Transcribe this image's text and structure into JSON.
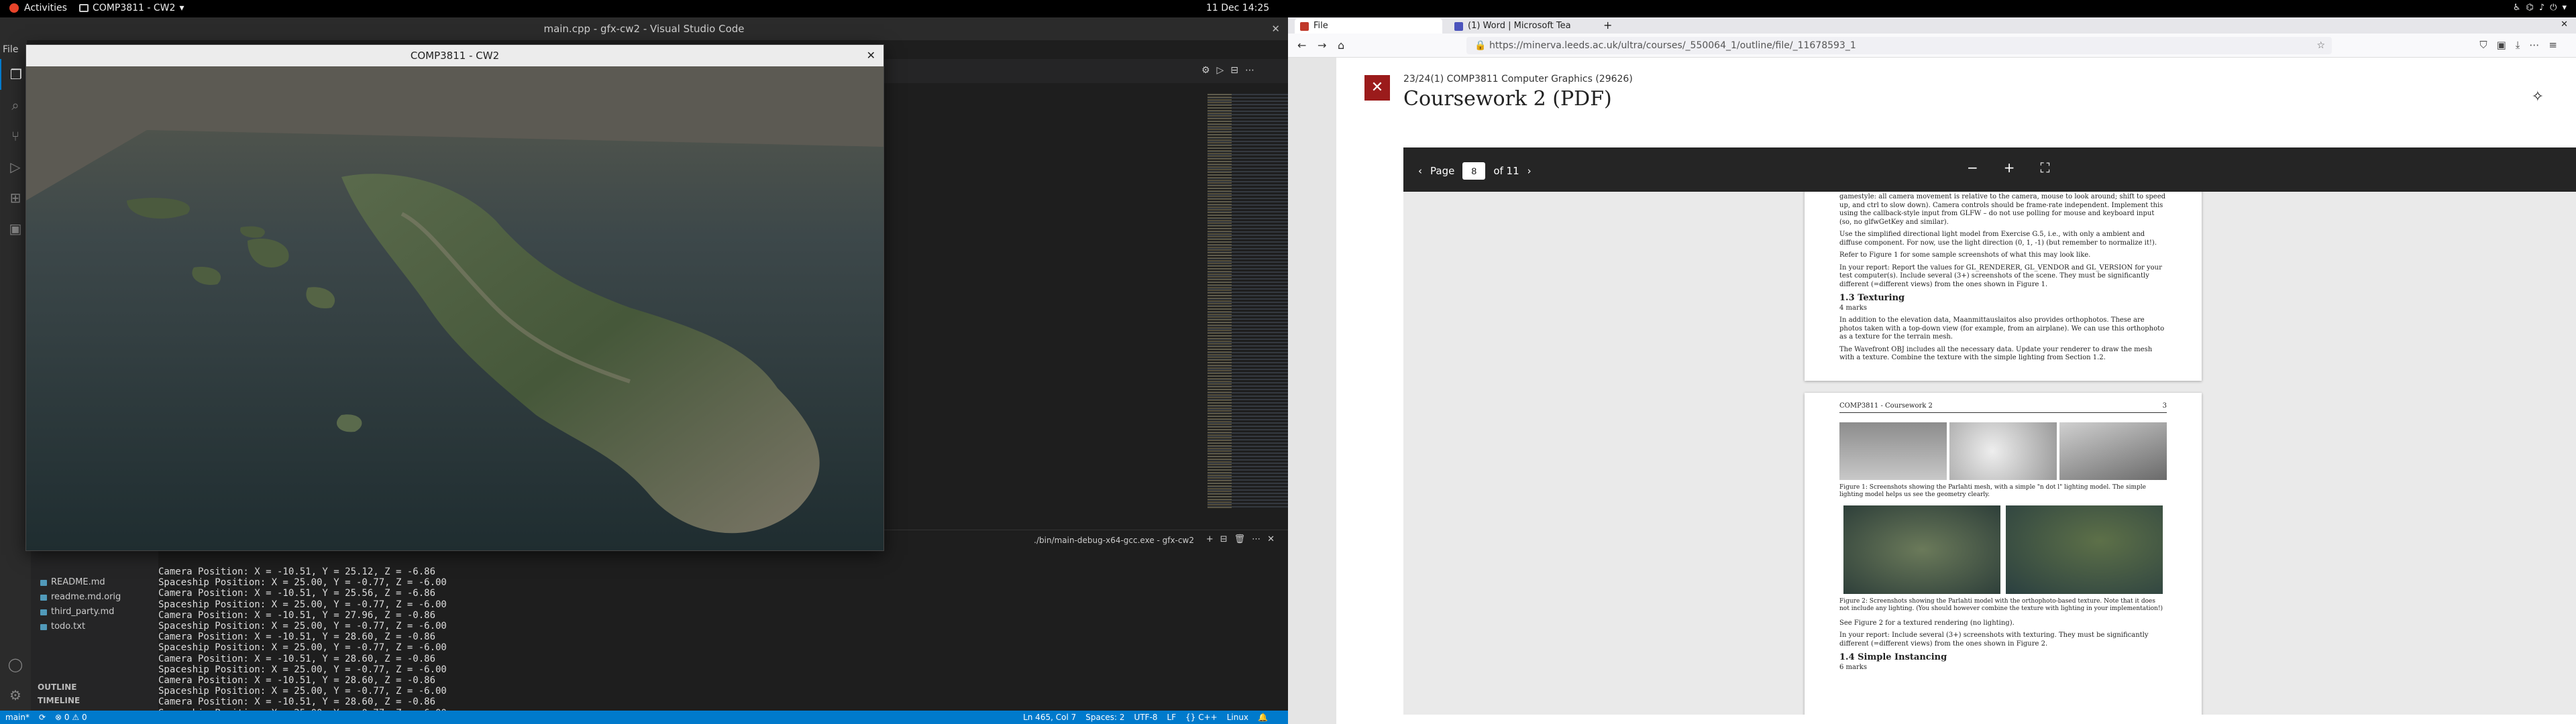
{
  "topbar": {
    "activities": "Activities",
    "app_name": "COMP3811 - CW2",
    "clock": "11 Dec  14:25"
  },
  "vscode": {
    "title": "main.cpp - gfx-cw2 - Visual Studio Code",
    "menu_first": "File",
    "files": [
      "README.md",
      "readme.md.orig",
      "third_party.md",
      "todo.txt"
    ],
    "outline_label": "OUTLINE",
    "timeline_label": "TIMELINE",
    "terminal_label": "./bin/main-debug-x64-gcc.exe - gfx-cw2",
    "terminal_lines": [
      "Camera Position: X = -10.51, Y = 25.12, Z = -6.86",
      "Spaceship Position: X = 25.00, Y = -0.77, Z = -6.00",
      "Camera Position: X = -10.51, Y = 25.56, Z = -6.86",
      "Spaceship Position: X = 25.00, Y = -0.77, Z = -6.00",
      "Camera Position: X = -10.51, Y = 27.96, Z = -0.86",
      "Spaceship Position: X = 25.00, Y = -0.77, Z = -6.00",
      "Camera Position: X = -10.51, Y = 28.60, Z = -0.86",
      "Spaceship Position: X = 25.00, Y = -0.77, Z = -6.00",
      "Camera Position: X = -10.51, Y = 28.60, Z = -0.86",
      "Spaceship Position: X = 25.00, Y = -0.77, Z = -6.00",
      "Camera Position: X = -10.51, Y = 28.60, Z = -0.86",
      "Spaceship Position: X = 25.00, Y = -0.77, Z = -6.00",
      "Camera Position: X = -10.51, Y = 28.60, Z = -0.86",
      "Spaceship Position: X = 25.00, Y = -0.77, Z = -6.00"
    ],
    "status": {
      "branch": "main*",
      "problems": "⊗ 0 ⚠ 0",
      "position": "Ln 465, Col 7",
      "spaces": "Spaces: 2",
      "encoding": "UTF-8",
      "eol": "LF",
      "language": "{} C++",
      "os": "Linux"
    }
  },
  "cw2_window": {
    "title": "COMP3811 - CW2"
  },
  "firefox": {
    "tabs": [
      {
        "label": "File",
        "color": "#c0392b"
      },
      {
        "label": "(1) Word | Microsoft Tea",
        "color": "#4b53bc"
      }
    ],
    "url": "https://minerva.leeds.ac.uk/ultra/courses/_550064_1/outline/file/_11678593_1",
    "course": "23/24(1) COMP3811 Computer Graphics (29626)",
    "doc_title": "Coursework 2 (PDF)",
    "pdf": {
      "page_label": "Page",
      "page_value": "8",
      "of_label": "of 11",
      "page1": {
        "p0": "gamestyle: all camera movement is relative to the camera, mouse to look around; shift to speed up, and ctrl to slow down). Camera controls should be frame-rate independent. Implement this using the callback-style input from GLFW – do not use polling for mouse and keyboard input (so, no glfwGetKey and similar).",
        "p1": "Use the simplified directional light model from Exercise G.5, i.e., with only a ambient and diffuse component. For now, use the light direction (0, 1, -1) (but remember to normalize it!).",
        "p2": "Refer to Figure 1 for some sample screenshots of what this may look like.",
        "p3": "In your report: Report the values for GL_RENDERER, GL_VENDOR and GL_VERSION for your test computer(s). Include several (3+) screenshots of the scene. They must be significantly different (=different views) from the ones shown in Figure 1.",
        "h": "1.3    Texturing",
        "marks": "4 marks",
        "p4": "In addition to the elevation data, Maanmittauslaitos also provides orthophotos. These are photos taken with a top-down view (for example, from an airplane). We can use this orthophoto as a texture for the terrain mesh.",
        "p5": "The Wavefront OBJ includes all the necessary data. Update your renderer to draw the mesh with a texture. Combine the texture with the simple lighting from Section 1.2."
      },
      "page2": {
        "header_left": "COMP3811 - Coursework 2",
        "header_right": "3",
        "cap1": "Figure 1: Screenshots showing the Parlahti mesh, with a simple \"n dot l\" lighting model. The simple lighting model helps us see the geometry clearly.",
        "cap2": "Figure 2: Screenshots showing the Parlahti model with the orthophoto-based texture. Note that it does not include any lighting. (You should however combine the texture with lighting in your implementation!)",
        "p1": "See Figure 2 for a textured rendering (no lighting).",
        "p2": "In your report: Include several (3+) screenshots with texturing. They must be significantly different (=different views) from the ones shown in Figure 2.",
        "h": "1.4    Simple Instancing",
        "marks": "6 marks"
      }
    }
  }
}
